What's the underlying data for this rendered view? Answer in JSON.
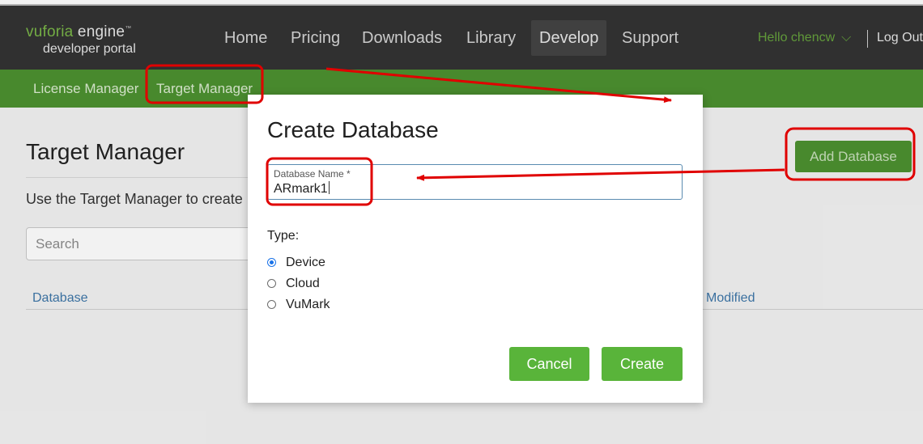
{
  "logo": {
    "brand": "vuforia",
    "product": "engine",
    "tm": "™",
    "subtitle": "developer portal"
  },
  "nav": {
    "items": [
      "Home",
      "Pricing",
      "Downloads",
      "Library",
      "Develop",
      "Support"
    ],
    "active": "Develop"
  },
  "user": {
    "greeting": "Hello chencw",
    "chevron": "⌵",
    "logout": "Log Out"
  },
  "subnav": {
    "items": [
      "License Manager",
      "Target Manager"
    ]
  },
  "page": {
    "title": "Target Manager",
    "description": "Use the Target Manager to create",
    "search_placeholder": "Search",
    "columns": [
      "Database",
      "Modified"
    ],
    "add_button": "Add Database"
  },
  "modal": {
    "title": "Create Database",
    "field_label": "Database Name *",
    "field_value": "ARmark1",
    "type_label": "Type:",
    "options": [
      "Device",
      "Cloud",
      "VuMark"
    ],
    "selected": "Device",
    "cancel": "Cancel",
    "create": "Create"
  },
  "colors": {
    "navbar": "#333333",
    "subnav": "#4c9130",
    "accent_green": "#59b43a",
    "link_blue": "#3e76a8",
    "annotation_red": "#e00000"
  }
}
